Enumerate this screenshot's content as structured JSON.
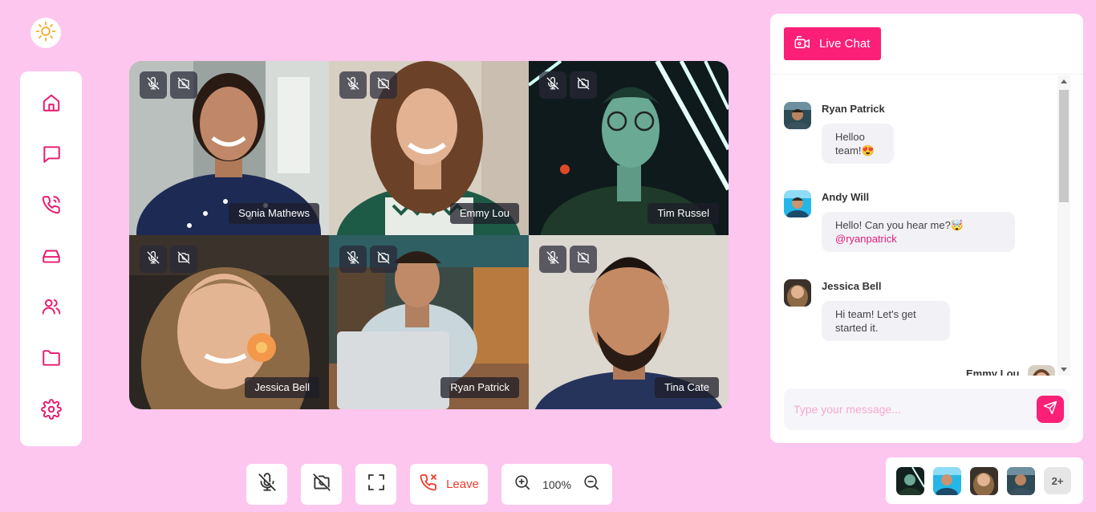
{
  "theme": {
    "icon": "sun-icon"
  },
  "sidebar": {
    "items": [
      {
        "icon": "home-icon"
      },
      {
        "icon": "chat-icon"
      },
      {
        "icon": "phone-call-icon"
      },
      {
        "icon": "inbox-icon"
      },
      {
        "icon": "users-icon"
      },
      {
        "icon": "folder-icon"
      },
      {
        "icon": "settings-icon"
      }
    ]
  },
  "video": {
    "participants": [
      {
        "name": "Sonia Mathews"
      },
      {
        "name": "Emmy Lou"
      },
      {
        "name": "Tim Russel"
      },
      {
        "name": "Jessica Bell"
      },
      {
        "name": "Ryan Patrick"
      },
      {
        "name": "Tina Cate"
      }
    ]
  },
  "chat": {
    "title": "Live Chat",
    "messages": [
      {
        "sender": "Ryan Patrick",
        "text": "Helloo team!😍",
        "mention": ""
      },
      {
        "sender": "Andy Will",
        "text": "Hello! Can you hear me?🤯",
        "mention": "@ryanpatrick"
      },
      {
        "sender": "Jessica Bell",
        "text": "Hi team! Let's get started it.",
        "mention": ""
      },
      {
        "sender": "Emmy Lou",
        "text": "",
        "mention": ""
      }
    ],
    "input_placeholder": "Type your message...",
    "input_value": ""
  },
  "toolbar": {
    "leave_label": "Leave",
    "zoom_level": "100%"
  },
  "participants_bar": {
    "more_label": "2+"
  },
  "colors": {
    "accent": "#fb1f78",
    "background": "#fdc6ee",
    "leave": "#f03a2a"
  }
}
